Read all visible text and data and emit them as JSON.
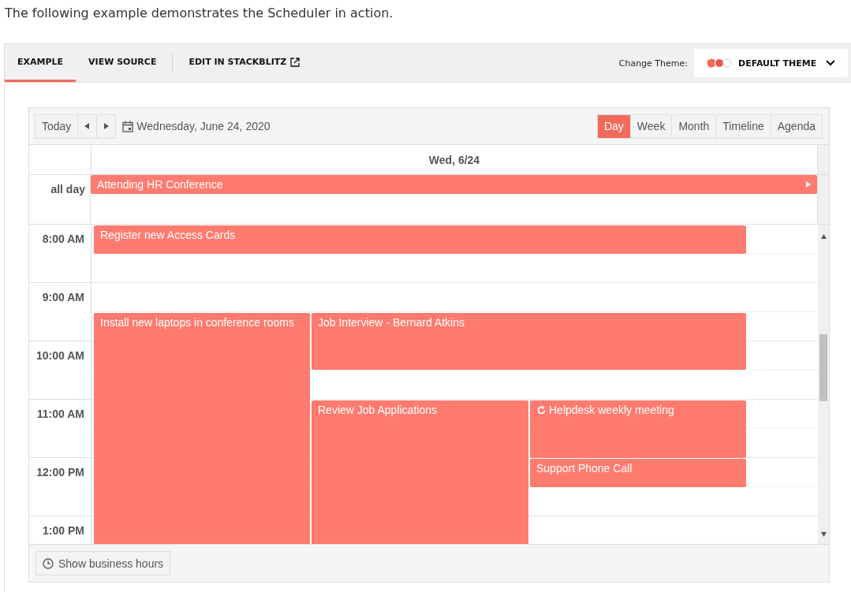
{
  "intro": "The following example demonstrates the Scheduler in action.",
  "tabs": [
    {
      "label": "EXAMPLE",
      "selected": true
    },
    {
      "label": "VIEW SOURCE",
      "selected": false
    },
    {
      "label": "EDIT IN STACKBLITZ",
      "selected": false,
      "external": true
    }
  ],
  "theme": {
    "label": "Change Theme:",
    "value": "DEFAULT THEME"
  },
  "toolbar": {
    "today": "Today",
    "date": "Wednesday, June 24, 2020",
    "views": [
      {
        "label": "Day",
        "selected": true
      },
      {
        "label": "Week",
        "selected": false
      },
      {
        "label": "Month",
        "selected": false
      },
      {
        "label": "Timeline",
        "selected": false
      },
      {
        "label": "Agenda",
        "selected": false
      }
    ]
  },
  "day_header": "Wed, 6/24",
  "all_day": {
    "label": "all day",
    "events": [
      {
        "title": "Attending HR Conference",
        "continues": true
      }
    ]
  },
  "times": [
    "8:00 AM",
    "9:00 AM",
    "10:00 AM",
    "11:00 AM",
    "12:00 PM",
    "1:00 PM"
  ],
  "events": [
    {
      "title": "Register new Access Cards",
      "recurring": false
    },
    {
      "title": "Install new laptops in conference rooms",
      "recurring": false
    },
    {
      "title": "Job Interview - Bernard Atkins",
      "recurring": false
    },
    {
      "title": "Review Job Applications",
      "recurring": false
    },
    {
      "title": "Helpdesk weekly meeting",
      "recurring": true
    },
    {
      "title": "Support Phone Call",
      "recurring": false
    }
  ],
  "footer": {
    "button": "Show business hours"
  }
}
